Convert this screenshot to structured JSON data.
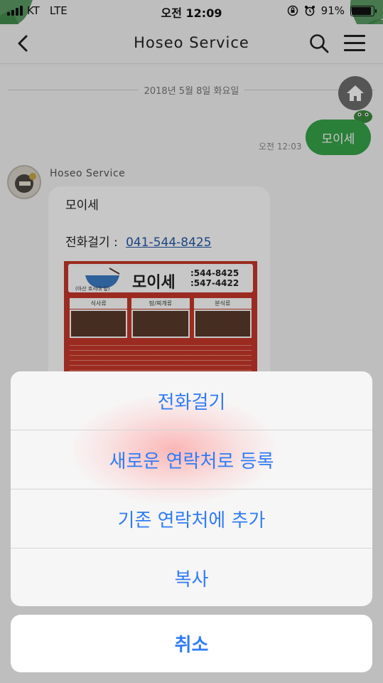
{
  "status_bar": {
    "carrier": "KT",
    "network": "LTE",
    "time": "오전 12:09",
    "battery": "91%",
    "battery_level": 0.91
  },
  "navbar": {
    "back_icon": "chevron-left-icon",
    "title": "Hoseo Service",
    "search_icon": "search-icon",
    "menu_icon": "hamburger-menu-icon"
  },
  "chat": {
    "date": "2018년 5월 8일 화요일",
    "home_icon": "home-icon",
    "outgoing": {
      "text": "모이세",
      "time": "오전 12:03"
    },
    "incoming": {
      "sender": "Hoseo Service",
      "name": "모이세",
      "phone_label": "전화걸기 :",
      "phone": "041-544-8425",
      "flyer": {
        "title": "모이세",
        "phones": [
          ":544-8425",
          ":547-4422"
        ],
        "subtitle": "(아산 호서대 앞)",
        "headers": [
          "식사류",
          "탕/찌개류",
          "분식류"
        ]
      }
    }
  },
  "action_sheet": {
    "options": [
      "전화걸기",
      "새로운 연락처로 등록",
      "기존 연락처에 추가",
      "복사"
    ],
    "cancel": "취소"
  },
  "colors": {
    "accent": "#2f7cf6",
    "bubble_out": "#37a34a",
    "flyer_red": "#c7382a"
  }
}
